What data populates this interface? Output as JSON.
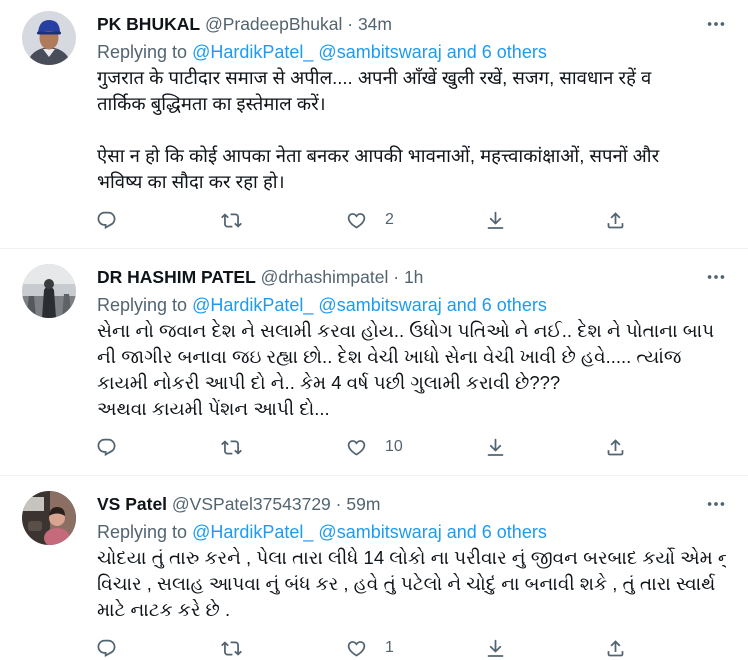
{
  "tweets": [
    {
      "author": {
        "name": "PK BHUKAL",
        "handle": "@PradeepBhukal"
      },
      "separator": "·",
      "time": "34m",
      "replying_to": {
        "label": "Replying to",
        "mentions": [
          "@HardikPatel_",
          "@sambitswaraj"
        ],
        "others": "and 6 others"
      },
      "paragraphs": [
        [
          "गुजरात के पाटीदार समाज से अपील.... अपनी आँखें खुली रखें, सजग, सावधान रहें व",
          "तार्किक बुद्धिमता का इस्तेमाल करें।"
        ],
        [
          "ऐसा न हो कि कोई आपका नेता बनकर आपकी भावनाओं, महत्त्वाकांक्षाओं, सपनों और",
          "भविष्य का सौदा कर रहा हो।"
        ]
      ],
      "like_count": "2"
    },
    {
      "author": {
        "name": "DR HASHIM PATEL",
        "handle": "@drhashimpatel"
      },
      "separator": "·",
      "time": "1h",
      "replying_to": {
        "label": "Replying to",
        "mentions": [
          "@HardikPatel_",
          "@sambitswaraj"
        ],
        "others": "and 6 others"
      },
      "paragraphs": [
        [
          "સેના નો જવાન દેશ ને સલામી કરવા હોય.. ઉધોગ પતિઓ ને નઈ.. દેશ ને પોતાના બાપ",
          "ની જાગીર બનાવા જઇ રહ્યા છો.. દેશ વેચી ખાધો સેના વેચી ખાવી છે હવે..... ત્યાંજ",
          "કાયમી નોકરી આપી દો ને.. કેમ 4 વર્ષ પછી ગુલામી કરાવી છે???",
          "અથવા કાયમી પેંશન આપી દો..."
        ]
      ],
      "like_count": "10"
    },
    {
      "author": {
        "name": "VS Patel",
        "handle": "@VSPatel37543729"
      },
      "separator": "·",
      "time": "59m",
      "replying_to": {
        "label": "Replying to",
        "mentions": [
          "@HardikPatel_",
          "@sambitswaraj"
        ],
        "others": "and 6 others"
      },
      "paragraphs": [
        [
          "ચોદયા તું તારુ કરને , પેલા તારા લીધે 14 લોકો ના પરીવાર નું જીવન બરબાદ કર્યો એમ નું",
          "વિચાર , સલાહ આપવા નું બંધ કર , હવે તું પટેલો ને ચોદું ના બનાવી શકે , તું તારા સ્વાર્થ",
          "માટે નાટક કરે છે ."
        ]
      ],
      "like_count": "1"
    }
  ],
  "icons": {
    "more": "more-icon",
    "reply": "reply-icon",
    "retweet": "retweet-icon",
    "like": "like-icon",
    "download": "download-icon",
    "share": "share-icon"
  },
  "colors": {
    "text": "#0f1419",
    "secondary": "#536471",
    "link": "#1d9bf0",
    "divider": "#eff3f4",
    "background": "#ffffff"
  }
}
